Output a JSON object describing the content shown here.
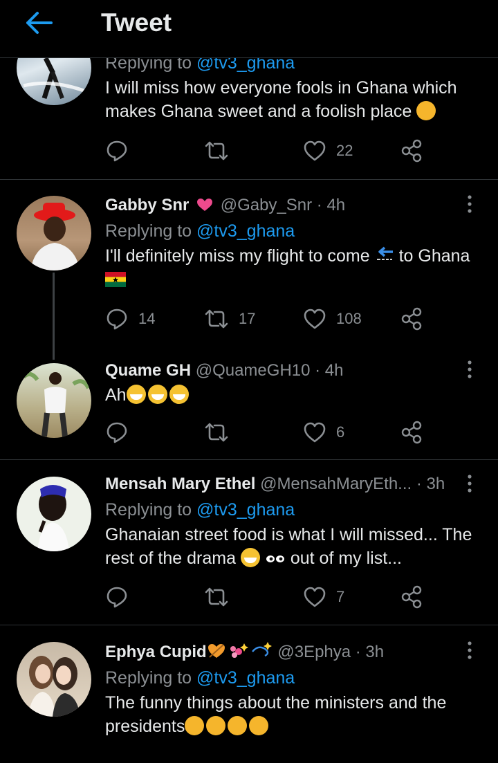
{
  "header": {
    "title": "Tweet"
  },
  "tweets": [
    {
      "reply_prefix": "Replying to ",
      "reply_to": "@tv3_ghana",
      "text": "I will miss how everyone fools in Ghana which makes Ghana sweet and a foolish place",
      "replies": "",
      "retweets": "",
      "likes": "22"
    },
    {
      "name": "Gabby Snr",
      "handle": "@Gaby_Snr · 4h",
      "reply_prefix": "Replying to ",
      "reply_to": "@tv3_ghana",
      "text_before": "I'll definitely miss my flight to come",
      "text_after": "to Ghana",
      "replies": "14",
      "retweets": "17",
      "likes": "108"
    },
    {
      "name": "Quame GH",
      "handle": "@QuameGH10 · 4h",
      "text": "Ah",
      "replies": "",
      "retweets": "",
      "likes": "6"
    },
    {
      "name": "Mensah Mary Ethel",
      "handle": "@MensahMaryEth... · 3h",
      "reply_prefix": "Replying to ",
      "reply_to": "@tv3_ghana",
      "text_line1": "Ghanaian street food is what I will missed... The",
      "text_line2a": "rest of the drama",
      "text_line2b": "out of my list...",
      "replies": "",
      "retweets": "",
      "likes": "7"
    },
    {
      "name": "Ephya Cupid",
      "handle": "@3Ephya · 3h",
      "reply_prefix": "Replying to ",
      "reply_to": "@tv3_ghana",
      "text_line1": "The funny things about the ministers and the",
      "text_line2": "presidents"
    }
  ],
  "icons": [
    "back-arrow-icon",
    "reply-icon",
    "retweet-icon",
    "like-icon",
    "share-icon",
    "more-icon"
  ],
  "colors": {
    "background": "#000000",
    "accent": "#1d9bf0",
    "muted": "#8b8f93",
    "text": "#e7e9ea"
  }
}
